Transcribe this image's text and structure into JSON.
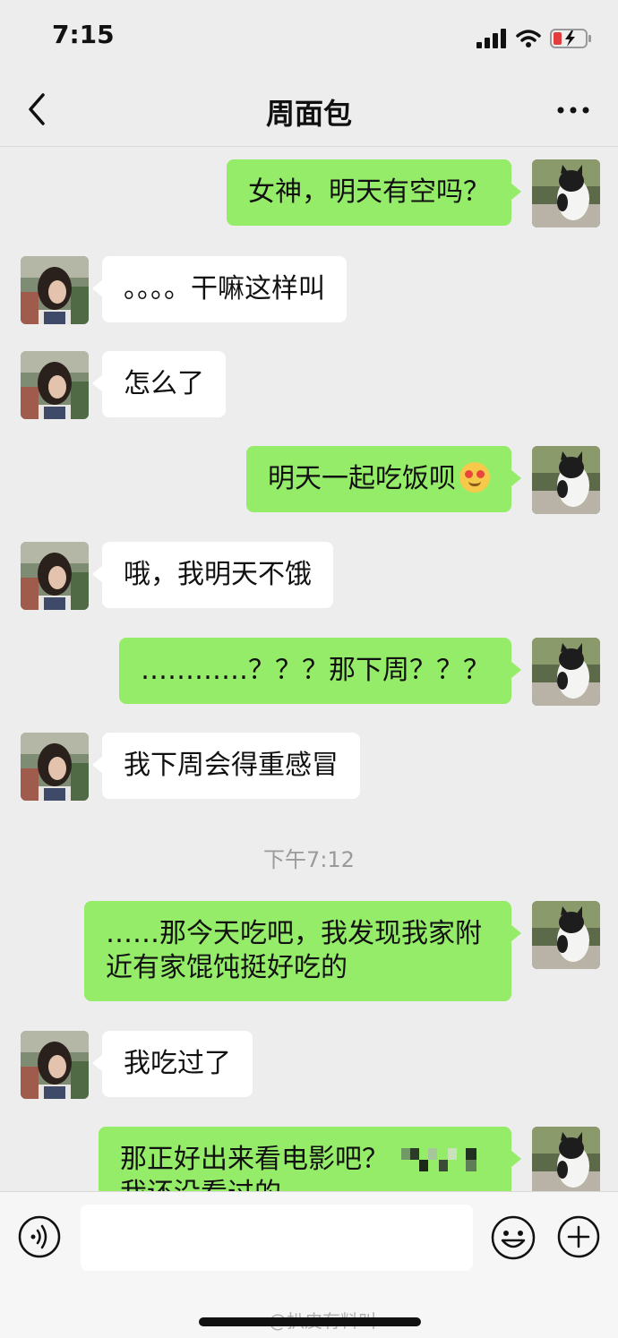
{
  "status_bar": {
    "time": "7:15"
  },
  "nav": {
    "title": "周面包"
  },
  "messages": [
    {
      "side": "out",
      "text": "女神，明天有空吗？"
    },
    {
      "side": "in",
      "text": "。。。。干嘛这样叫"
    },
    {
      "side": "in",
      "text": "怎么了"
    },
    {
      "side": "out",
      "text": "明天一起吃饭呗"
    },
    {
      "side": "in",
      "text": "哦，我明天不饿"
    },
    {
      "side": "out",
      "text": "…………？？？那下周？？？"
    },
    {
      "side": "in",
      "text": "我下周会得重感冒"
    },
    {
      "side": "out",
      "text": "……那今天吃吧，我发现我家附近有家馄饨挺好吃的"
    },
    {
      "side": "in",
      "text": "我吃过了"
    },
    {
      "side": "out",
      "text": "那正好出来看电影吧？"
    },
    {
      "side": "out",
      "text": "我还没看过的"
    }
  ],
  "timestamp": "下午7:12",
  "emoji_icon": "heart-eyes-emoji",
  "colors": {
    "outgoing_bubble": "#95ec69",
    "incoming_bubble": "#ffffff",
    "background": "#ededed"
  },
  "watermark": "@扒皮有料叫"
}
